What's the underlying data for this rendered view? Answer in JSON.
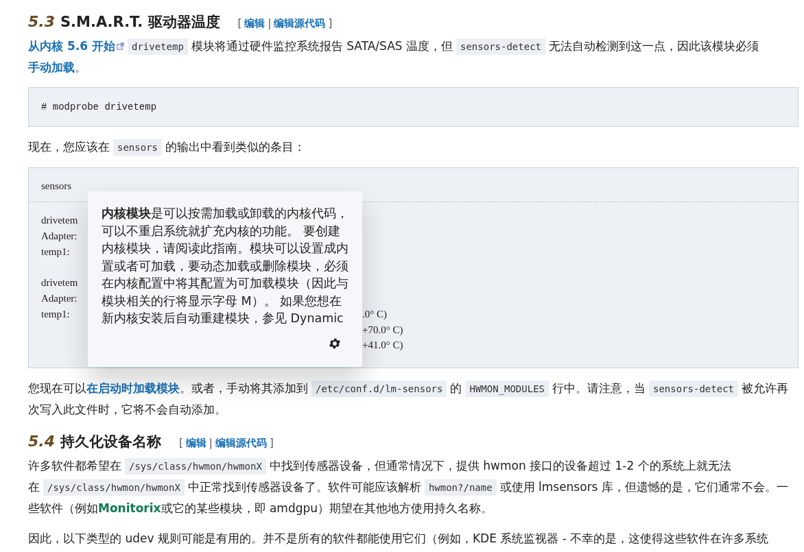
{
  "sections": [
    {
      "number": "5.3",
      "title": "S.M.A.R.T. 驱动器温度",
      "edit_links": [
        "编辑",
        "编辑源代码"
      ],
      "edit_open": "[",
      "edit_sep": "|",
      "edit_close": "]",
      "blocks": [
        {
          "kind": "para",
          "segments": [
            {
              "kind": "extlink",
              "text": "从内核 5.6 开始"
            },
            {
              "kind": "code",
              "text": "drivetemp"
            },
            {
              "kind": "text",
              "text": "模块将通过硬件监控系统报告 SATA/SAS 温度，但"
            },
            {
              "kind": "code",
              "text": "sensors-detect"
            },
            {
              "kind": "text",
              "text": "无法自动检测到这一点，因此该模块必须"
            },
            {
              "kind": "link",
              "text": "手动加载"
            },
            {
              "kind": "text",
              "text": "。"
            }
          ]
        },
        {
          "kind": "code",
          "lines": [
            "# modprobe drivetemp"
          ]
        },
        {
          "kind": "para",
          "segments": [
            {
              "kind": "text",
              "text": "现在，您应该在"
            },
            {
              "kind": "code",
              "text": "sensors"
            },
            {
              "kind": "text",
              "text": "的输出中看到类似的条目："
            }
          ]
        },
        {
          "kind": "output",
          "command": "sensors",
          "groups": [
            [
              {
                "left": "drivetem"
              },
              {
                "left": "Adapter:"
              },
              {
                "left": "temp1:"
              }
            ],
            [
              {
                "left": "drivetem"
              },
              {
                "left": "Adapter:"
              },
              {
                "left": "temp1:",
                "right": ".0° C)"
              },
              {
                "right": "+70.0° C)"
              },
              {
                "right": "+41.0° C)"
              }
            ]
          ],
          "tooltip": {
            "text": "**内核模块**是可以按需加载或卸载的内核代码，可以不重启系统就扩充内核的功能。 要创建内核模块，请阅读此指南。模块可以设置成内置或者可加载，要动态加载或删除模块，必须在内核配置中将其配置为可加载模块（因此与模块相关的行将显示字母 M）。 如果您想在新内核安装后自动重建模块，参见 Dynamic"
          }
        },
        {
          "kind": "para",
          "segments": [
            {
              "kind": "text",
              "text": "您现在可以"
            },
            {
              "kind": "link",
              "text": "在启动时加载模块"
            },
            {
              "kind": "text",
              "text": "。或者，手动将其添加到"
            },
            {
              "kind": "code",
              "text": "/etc/conf.d/lm-sensors"
            },
            {
              "kind": "text",
              "text": "的"
            },
            {
              "kind": "code",
              "text": "HWMON_MODULES"
            },
            {
              "kind": "text",
              "text": "行中。请注意，当"
            },
            {
              "kind": "code",
              "text": "sensors-detect"
            },
            {
              "kind": "text",
              "text": "被允许再次写入此文件时，它将不会自动添加。"
            }
          ]
        }
      ]
    },
    {
      "number": "5.4",
      "title": "持久化设备名称",
      "edit_links": [
        "编辑",
        "编辑源代码"
      ],
      "edit_open": "[",
      "edit_sep": "|",
      "edit_close": "]",
      "blocks": [
        {
          "kind": "para",
          "segments": [
            {
              "kind": "text",
              "text": "许多软件都希望在"
            },
            {
              "kind": "code",
              "text": "/sys/class/hwmon/hwmonX"
            },
            {
              "kind": "text",
              "text": "中找到传感器设备，但通常情况下，提供 hwmon 接口的设备超过 1-2 个的系统上就无法在"
            },
            {
              "kind": "code",
              "text": "/sys/class/hwmon/hwmonX"
            },
            {
              "kind": "text",
              "text": "中正常找到传感器设备了。软件可能应该解析"
            },
            {
              "kind": "code",
              "text": "hwmon?/name"
            },
            {
              "kind": "text",
              "text": "或使用 lmsensors 库，但遗憾的是，它们通常不会。一些软件（例如"
            },
            {
              "kind": "pkglink",
              "text": "Monitorix"
            },
            {
              "kind": "text",
              "text": "或它的某些模块，即 amdgpu）期望在其他地方使用持久名称。"
            }
          ]
        },
        {
          "kind": "para",
          "segments": [
            {
              "kind": "text",
              "text": "因此，以下类型的 udev 规则可能是有用的。并不是所有的软件都能使用它们（例如，KDE 系统监视器 - 不幸的是，这使得这些软件在许多系统"
            }
          ]
        }
      ]
    }
  ]
}
